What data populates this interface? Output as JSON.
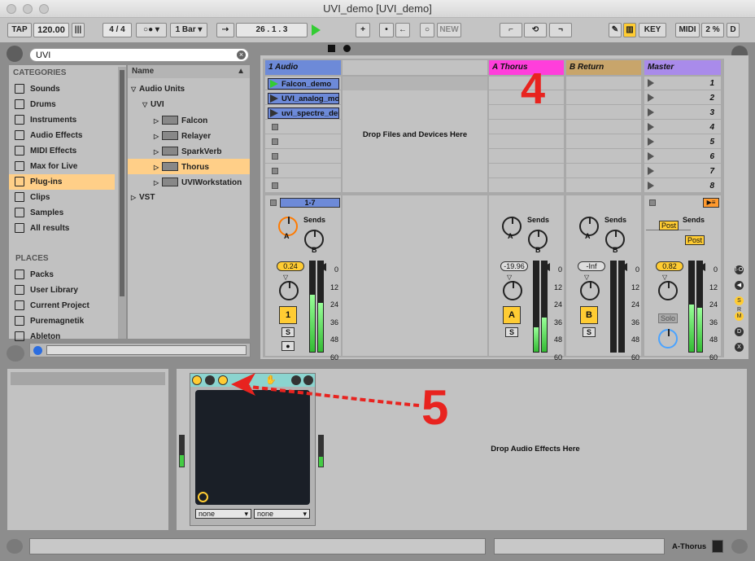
{
  "window": {
    "title": "UVI_demo  [UVI_demo]"
  },
  "control_bar": {
    "tap": "TAP",
    "tempo": "120.00",
    "time_sig": "4  /  4",
    "quantize": "1 Bar",
    "position": "26 .   1 .   3",
    "new": "NEW",
    "key": "KEY",
    "midi": "MIDI",
    "cpu": "2 %",
    "d": "D"
  },
  "browser": {
    "search_value": "UVI",
    "categories_header": "CATEGORIES",
    "categories": [
      {
        "label": "Sounds",
        "icon": "sounds-icon"
      },
      {
        "label": "Drums",
        "icon": "drums-icon"
      },
      {
        "label": "Instruments",
        "icon": "instruments-icon"
      },
      {
        "label": "Audio Effects",
        "icon": "audio-effects-icon"
      },
      {
        "label": "MIDI Effects",
        "icon": "midi-effects-icon"
      },
      {
        "label": "Max for Live",
        "icon": "max-icon"
      },
      {
        "label": "Plug-ins",
        "icon": "plugins-icon"
      },
      {
        "label": "Clips",
        "icon": "clips-icon"
      },
      {
        "label": "Samples",
        "icon": "samples-icon"
      },
      {
        "label": "All results",
        "icon": "search-icon"
      }
    ],
    "places_header": "PLACES",
    "places": [
      {
        "label": "Packs"
      },
      {
        "label": "User Library"
      },
      {
        "label": "Current Project"
      },
      {
        "label": "Puremagnetik"
      },
      {
        "label": "Ableton"
      }
    ],
    "name_header": "Name",
    "files": [
      {
        "label": "Audio Units",
        "indent": 0,
        "open": true
      },
      {
        "label": "UVI",
        "indent": 1,
        "open": true
      },
      {
        "label": "Falcon",
        "indent": 2,
        "plugin": true
      },
      {
        "label": "Relayer",
        "indent": 2,
        "plugin": true
      },
      {
        "label": "SparkVerb",
        "indent": 2,
        "plugin": true
      },
      {
        "label": "Thorus",
        "indent": 2,
        "plugin": true,
        "selected": true
      },
      {
        "label": "UVIWorkstation",
        "indent": 2,
        "plugin": true
      },
      {
        "label": "VST",
        "indent": 0,
        "open": false
      }
    ]
  },
  "session": {
    "tracks": [
      {
        "name": "1 Audio",
        "color": "#6d8ad8"
      },
      {
        "name": "A Thorus",
        "color": "#ff3edb"
      },
      {
        "name": "B Return",
        "color": "#c8a56b"
      },
      {
        "name": "Master",
        "color": "#a98bea"
      }
    ],
    "clips": [
      "Falcon_demo",
      "UVI_analog_mot",
      "uvi_spectre_der"
    ],
    "drop_text": "Drop Files and Devices Here",
    "scenes": [
      "1",
      "2",
      "3",
      "4",
      "5",
      "6",
      "7",
      "8"
    ],
    "io_label": "1-7",
    "sends_label": "Sends",
    "send_a": "A",
    "send_b": "B",
    "post": "Post",
    "volumes": [
      "0.24",
      "-19.96",
      "-Inf",
      "0.82"
    ],
    "track_buttons": [
      "1",
      "A",
      "B"
    ],
    "solo_label": "S",
    "master_solo": "Solo",
    "meter_scale": [
      "0",
      "12",
      "24",
      "36",
      "48",
      "60"
    ]
  },
  "annotations": {
    "four": "4",
    "five": "5"
  },
  "detail": {
    "drop_audio_effects": "Drop Audio Effects Here",
    "xy_x": "none",
    "xy_y": "none"
  },
  "statusbar": {
    "track": "A-Thorus"
  }
}
